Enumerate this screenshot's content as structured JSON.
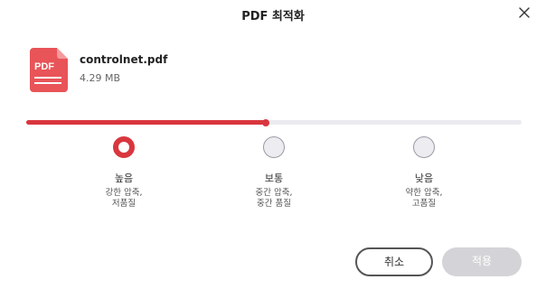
{
  "dialog": {
    "title": "PDF 최적화",
    "close_label": "close"
  },
  "file": {
    "icon_label": "PDF",
    "name": "controlnet.pdf",
    "size": "4.29 MB"
  },
  "compression": {
    "level_fraction": 0.484,
    "selected_index": 0,
    "options": [
      {
        "label": "높음",
        "desc_line1": "강한 압축,",
        "desc_line2": "저품질"
      },
      {
        "label": "보통",
        "desc_line1": "중간 압축,",
        "desc_line2": "중간 품질"
      },
      {
        "label": "낮음",
        "desc_line1": "약한 압축,",
        "desc_line2": "고품질"
      }
    ]
  },
  "buttons": {
    "cancel": "취소",
    "apply": "적용"
  },
  "colors": {
    "accent": "#d9363e",
    "track": "#ebebf0",
    "disabled_button": "#d4d4d8"
  }
}
